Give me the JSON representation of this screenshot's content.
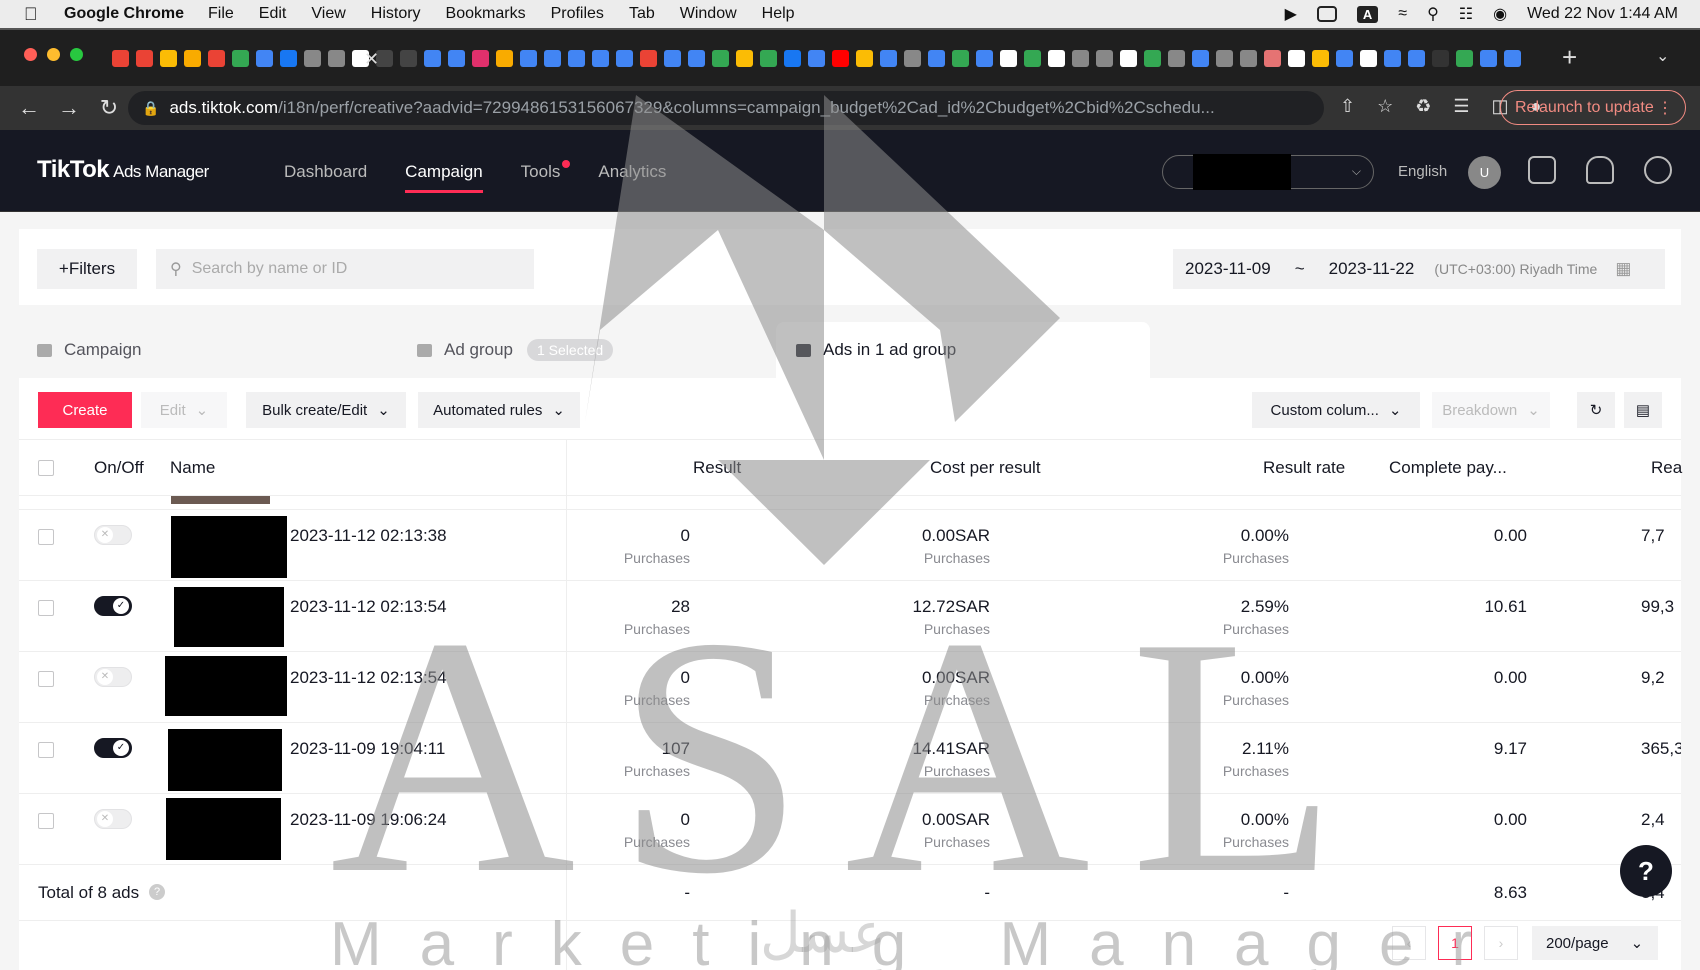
{
  "menubar": {
    "app_name": "Google Chrome",
    "items": [
      "File",
      "Edit",
      "View",
      "History",
      "Bookmarks",
      "Profiles",
      "Tab",
      "Window",
      "Help"
    ],
    "input_badge": "A",
    "datetime": "Wed 22 Nov  1:44 AM"
  },
  "browser": {
    "url_host": "ads.tiktok.com",
    "url_path": "/i18n/perf/creative?aadvid=7299486153156067329&columns=campaign_budget%2Cad_id%2Cbudget%2Cbid%2Cschedu...",
    "relaunch_label": "Relaunch to update"
  },
  "header": {
    "logo": "TikTok",
    "logo_sub": "Ads Manager",
    "nav": [
      "Dashboard",
      "Campaign",
      "Tools",
      "Analytics"
    ],
    "active_nav": "Campaign",
    "language": "English",
    "avatar_letter": "U"
  },
  "filters": {
    "filters_label": "+Filters",
    "search_placeholder": "Search by name or ID",
    "date_start": "2023-11-09",
    "date_sep": "~",
    "date_end": "2023-11-22",
    "timezone": "(UTC+03:00) Riyadh Time"
  },
  "level_tabs": {
    "campaign": "Campaign",
    "ad_group": "Ad group",
    "selected_chip": "1 Selected",
    "ads": "Ads in 1 ad group"
  },
  "toolbar": {
    "create": "Create",
    "edit": "Edit",
    "bulk": "Bulk create/Edit",
    "automated": "Automated rules",
    "custom_columns": "Custom colum...",
    "breakdown": "Breakdown"
  },
  "table": {
    "headers": {
      "onoff": "On/Off",
      "name": "Name",
      "result": "Result",
      "cost": "Cost per result",
      "rate": "Result rate",
      "complete": "Complete pay...",
      "reach": "Rea"
    },
    "rows": [
      {
        "on": false,
        "name": "2023-11-12 02:13:38",
        "result": "0",
        "result_sub": "Purchases",
        "cost": "0.00SAR",
        "cost_sub": "Purchases",
        "rate": "0.00%",
        "rate_sub": "Purchases",
        "complete": "0.00",
        "reach": "7,7"
      },
      {
        "on": true,
        "name": "2023-11-12 02:13:54",
        "result": "28",
        "result_sub": "Purchases",
        "cost": "12.72SAR",
        "cost_sub": "Purchases",
        "rate": "2.59%",
        "rate_sub": "Purchases",
        "complete": "10.61",
        "reach": "99,3"
      },
      {
        "on": false,
        "name": "2023-11-12 02:13:54",
        "result": "0",
        "result_sub": "Purchases",
        "cost": "0.00SAR",
        "cost_sub": "Purchases",
        "rate": "0.00%",
        "rate_sub": "Purchases",
        "complete": "0.00",
        "reach": "9,2"
      },
      {
        "on": true,
        "name": "2023-11-09 19:04:11",
        "result": "107",
        "result_sub": "Purchases",
        "cost": "14.41SAR",
        "cost_sub": "Purchases",
        "rate": "2.11%",
        "rate_sub": "Purchases",
        "complete": "9.17",
        "reach": "365,3"
      },
      {
        "on": false,
        "name": "2023-11-09 19:06:24",
        "result": "0",
        "result_sub": "Purchases",
        "cost": "0.00SAR",
        "cost_sub": "Purchases",
        "rate": "0.00%",
        "rate_sub": "Purchases",
        "complete": "0.00",
        "reach": "2,4"
      }
    ],
    "total": {
      "label": "Total of 8 ads",
      "result": "-",
      "cost": "-",
      "rate": "-",
      "complete": "8.63",
      "reach": "8,4"
    }
  },
  "pagination": {
    "current": "1",
    "page_size": "200/page"
  },
  "watermark": {
    "brand": "ASAL",
    "subtitle": "Marketing Manager",
    "arabic": "عسل"
  }
}
